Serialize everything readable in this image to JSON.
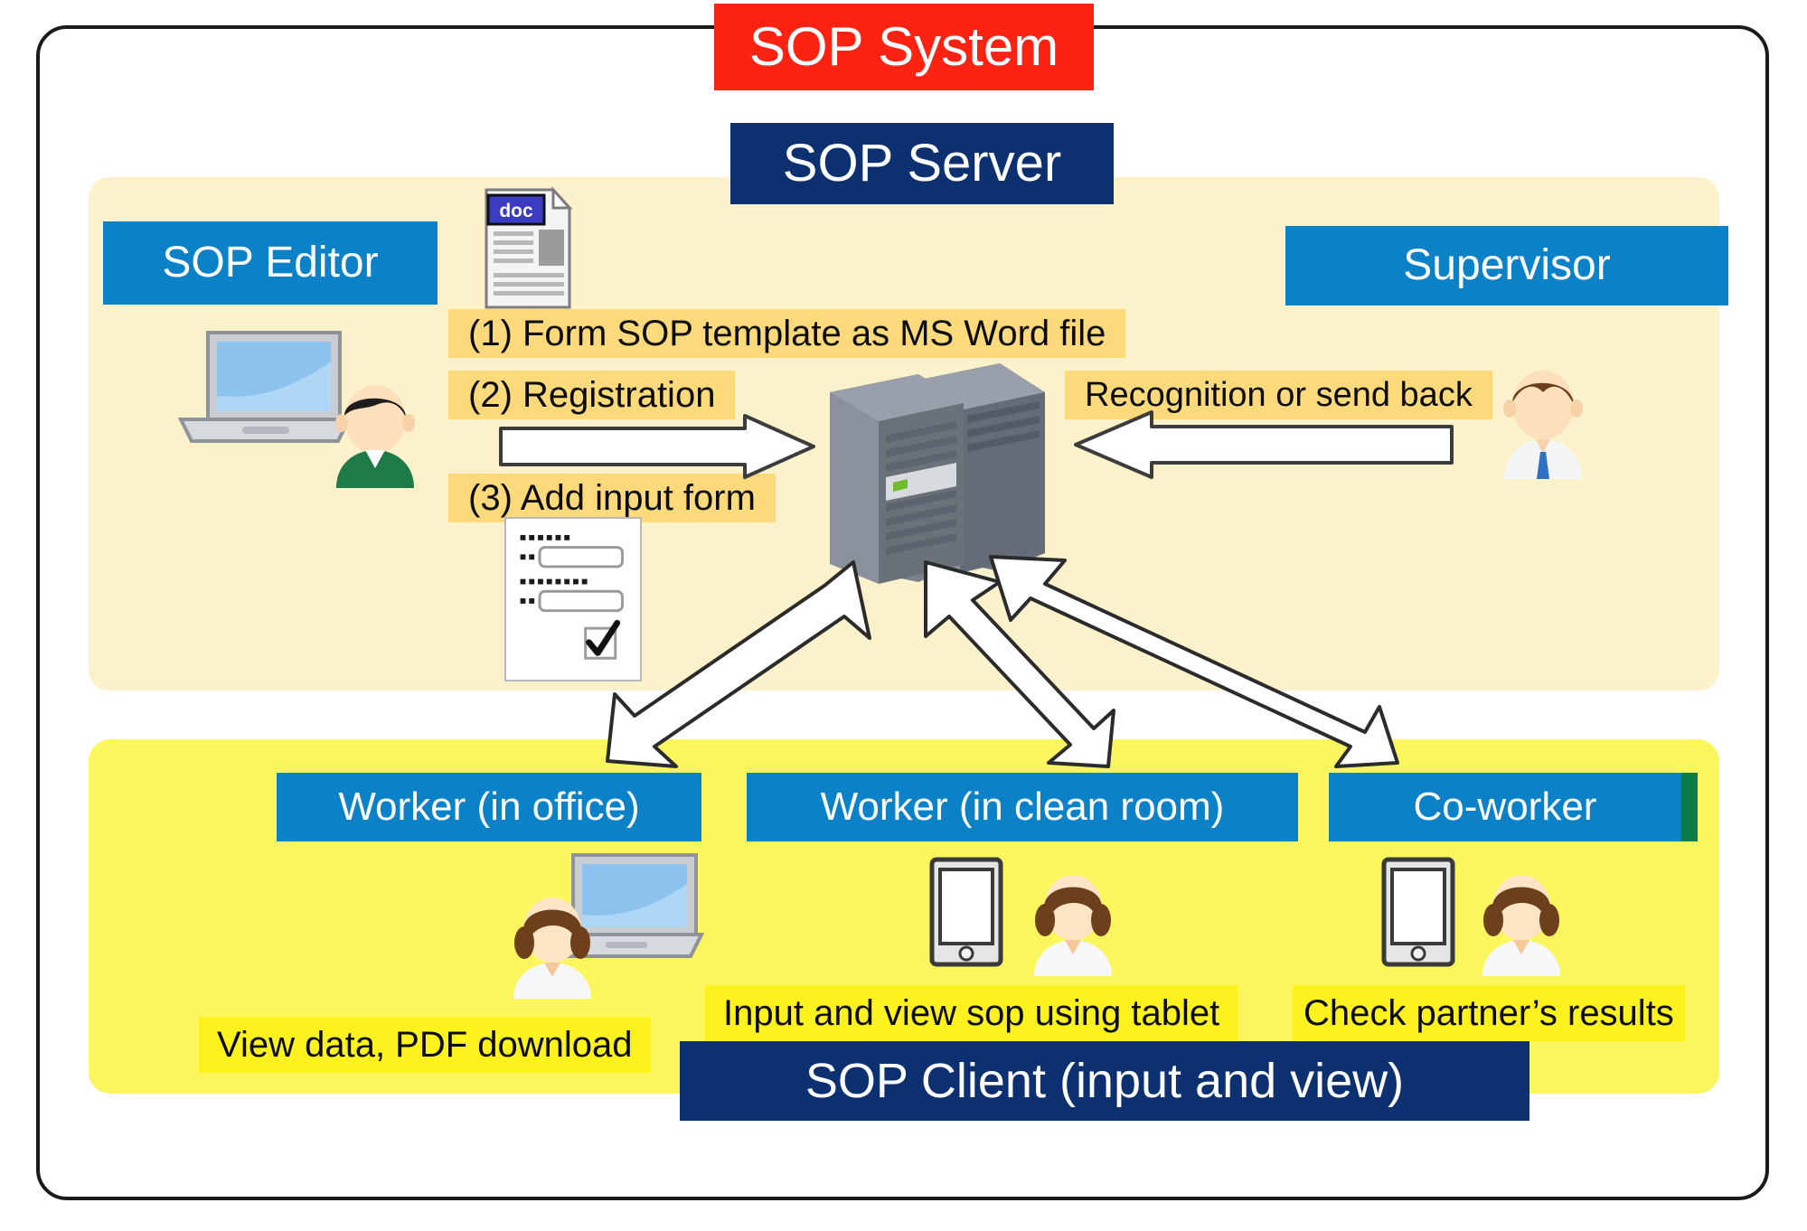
{
  "diagram": {
    "title": "SOP System",
    "server_title": "SOP Server",
    "client_title": "SOP Client (input and view)"
  },
  "actors": {
    "editor": "SOP Editor",
    "supervisor": "Supervisor",
    "worker_office": "Worker (in office)",
    "worker_clean_room": "Worker (in clean room)",
    "coworker": "Co-worker"
  },
  "steps": [
    {
      "id": "step1",
      "label": "(1) Form SOP template as MS Word file"
    },
    {
      "id": "step2",
      "label": "(2) Registration"
    },
    {
      "id": "step3",
      "label": "(3) Add input form"
    }
  ],
  "flows": {
    "supervisor_feedback": "Recognition or send back"
  },
  "captions": {
    "worker_office": "View data, PDF download",
    "worker_clean_room": "Input and view sop using tablet",
    "coworker": "Check partner’s results"
  },
  "icons": {
    "doc_badge": "doc"
  },
  "colors": {
    "accent_red": "#fd2211",
    "accent_navy": "#0d3071",
    "accent_blue": "#0b82c8",
    "panel_cream": "#fbf2cc",
    "panel_yellow": "#fbf55e",
    "label_amber": "#fcd97a",
    "label_yellow": "#fdf11e",
    "frame_black": "#1a1a1a"
  }
}
